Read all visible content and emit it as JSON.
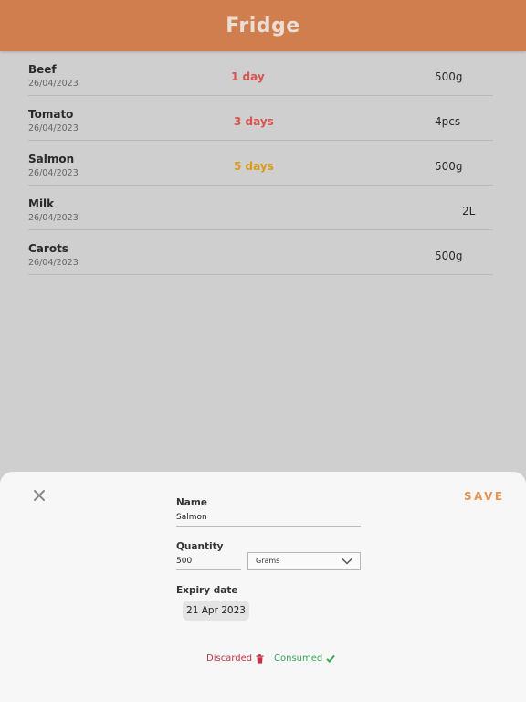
{
  "header": {
    "title": "Fridge"
  },
  "items": [
    {
      "name": "Beef",
      "date": "26/04/2023",
      "expiry": "1 day",
      "expiry_color": "#d9534f",
      "quantity": "500g"
    },
    {
      "name": "Tomato",
      "date": "26/04/2023",
      "expiry": "3 days",
      "expiry_color": "#d9534f",
      "quantity": "4pcs"
    },
    {
      "name": "Salmon",
      "date": "26/04/2023",
      "expiry": "5 days",
      "expiry_color": "#d99a1a",
      "quantity": "500g"
    },
    {
      "name": "Milk",
      "date": "26/04/2023",
      "expiry": "",
      "expiry_color": "#d9534f",
      "quantity": "2L"
    },
    {
      "name": "Carots",
      "date": "26/04/2023",
      "expiry": "",
      "expiry_color": "#d9534f",
      "quantity": "500g"
    }
  ],
  "sheet": {
    "close_icon": "close-icon",
    "save_label": "SAVE",
    "name_label": "Name",
    "name_value": "Salmon",
    "quantity_label": "Quantity",
    "quantity_value": "500",
    "unit_value": "Grams",
    "expiry_label": "Expiry date",
    "expiry_value": "21 Apr 2023",
    "discarded_label": "Discarded",
    "consumed_label": "Consumed",
    "accent_color": "#e69250"
  }
}
